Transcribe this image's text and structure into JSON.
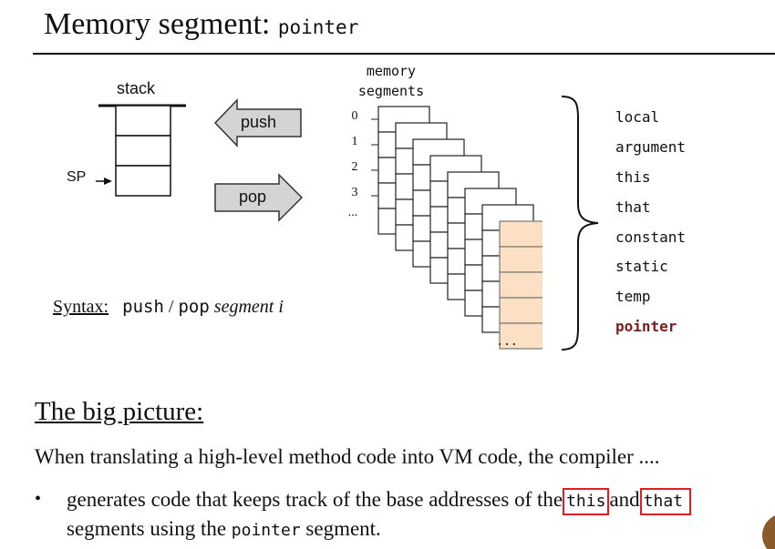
{
  "slide": {
    "title_text": "Memory segment: ",
    "title_code": "pointer"
  },
  "stack": {
    "label": "stack",
    "sp_label": "SP"
  },
  "arrows": {
    "push": "push",
    "pop": "pop"
  },
  "memory": {
    "label_line1": "memory",
    "label_line2": "segments",
    "indices": [
      "0",
      "1",
      "2",
      "3",
      "..."
    ],
    "last_cell": "..."
  },
  "segments": [
    "local",
    "argument",
    "this",
    "that",
    "constant",
    "static",
    "temp",
    "pointer"
  ],
  "syntax": {
    "label": "Syntax:",
    "push": "push",
    "slash": " / ",
    "pop": "pop",
    "segment": "segment",
    "i": "i"
  },
  "big_picture": {
    "heading": "The big picture:",
    "paragraph": "When translating a high-level method code into VM code, the compiler ....",
    "bullet_marker": "•",
    "bullet_part1": "generates code that keeps track of the base addresses of the",
    "this_code": "this",
    "and_word": "and",
    "that_code": "that",
    "line2_part1": "segments using the ",
    "line2_code": "pointer",
    "line2_part2": " segment."
  },
  "colors": {
    "highlight": "#7b1d1d",
    "callout_box": "#e02020",
    "pointer_cell": "#fbe0c3",
    "arrow_fill": "#d4d4d4"
  }
}
